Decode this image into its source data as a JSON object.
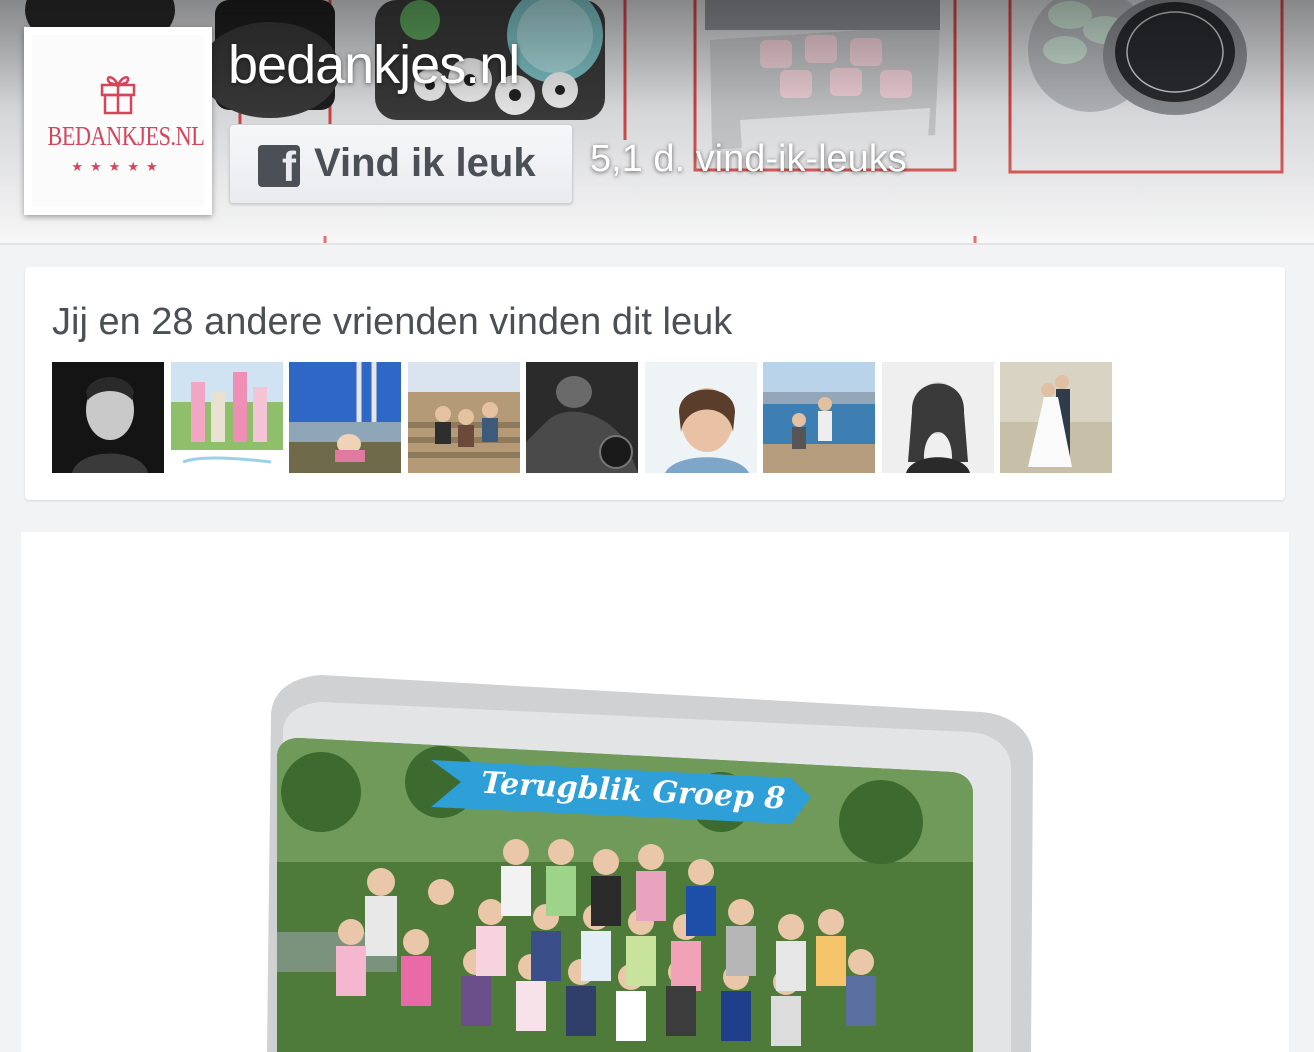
{
  "page": {
    "name": "bedankjes.nl",
    "logo_text": "BEDANKJES.NL",
    "logo_stars": "★★★★★",
    "like_button_label": "Vind ik leuk",
    "like_count": "5,1 d. vind-ik-leuks"
  },
  "friends": {
    "summary": "Jij en 28 andere vrienden vinden dit leuk",
    "avatar_count": 9
  },
  "post": {
    "banner_text": "Terugblik Groep 8"
  },
  "colors": {
    "brand": "#d6455b",
    "facebook_gray": "#4b4f56",
    "banner_blue": "#2f9fd8"
  }
}
